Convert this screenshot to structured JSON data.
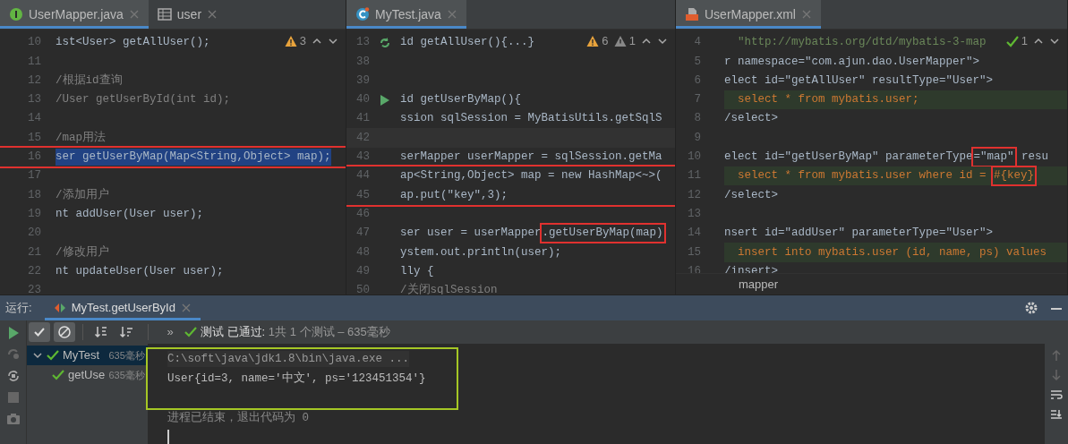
{
  "editors": [
    {
      "tabs": [
        {
          "label": "UserMapper.java",
          "kind": "interface",
          "selected": true
        },
        {
          "label": "user",
          "kind": "table",
          "selected": false
        }
      ],
      "inspections": [
        {
          "kind": "warning",
          "count": "3"
        }
      ],
      "lines": [
        {
          "num": "10",
          "kind": "code",
          "code": "ist<User> getAllUser();"
        },
        {
          "num": "11"
        },
        {
          "num": "12",
          "kind": "comment",
          "code": "/根据id查询"
        },
        {
          "num": "13",
          "kind": "comment",
          "code": "/User getUserById(int id);"
        },
        {
          "num": "14"
        },
        {
          "num": "15",
          "kind": "comment",
          "code": "/map用法"
        },
        {
          "num": "16",
          "kind": "code",
          "code": "ser getUserByMap(Map<String,Object> map);",
          "text_selected": true,
          "boxed": true
        },
        {
          "num": "17"
        },
        {
          "num": "18",
          "kind": "comment",
          "code": "/添加用户"
        },
        {
          "num": "19",
          "kind": "code",
          "code": "nt addUser(User user);"
        },
        {
          "num": "20"
        },
        {
          "num": "21",
          "kind": "comment",
          "code": "/修改用户"
        },
        {
          "num": "22",
          "kind": "code",
          "code": "nt updateUser(User user);"
        },
        {
          "num": "23"
        }
      ]
    },
    {
      "tabs": [
        {
          "label": "MyTest.java",
          "kind": "class",
          "selected": true
        }
      ],
      "inspections": [
        {
          "kind": "warning",
          "count": "6"
        },
        {
          "kind": "weak",
          "count": "1"
        }
      ],
      "lines": [
        {
          "num": "13",
          "kind": "code",
          "code": "id getAllUser(){...}",
          "gutter": {
            "kind": "rerun"
          }
        },
        {
          "num": "38"
        },
        {
          "num": "39"
        },
        {
          "num": "40",
          "kind": "code",
          "code": "id getUserByMap(){",
          "gutter": {
            "kind": "run"
          }
        },
        {
          "num": "41",
          "kind": "code",
          "code": "ssion sqlSession = MyBatisUtils.getSqlS"
        },
        {
          "num": "42",
          "current_line": true
        },
        {
          "num": "43",
          "kind": "code",
          "code": "serMapper userMapper = sqlSession.getMa"
        },
        {
          "num": "44",
          "kind": "code",
          "code": "ap<String,Object> map = new HashMap<~>(",
          "boxed": true
        },
        {
          "num": "45",
          "kind": "code",
          "code": "ap.put(\"key\",3);",
          "boxed": true
        },
        {
          "num": "46"
        },
        {
          "num": "47",
          "kind": "code",
          "code": "ser user = userMapper",
          "boxed_part": ".getUserByMap(map)"
        },
        {
          "num": "48",
          "kind": "code",
          "code": "ystem.out.println(user);"
        },
        {
          "num": "49",
          "kind": "code",
          "code": "lly {"
        },
        {
          "num": "50",
          "kind": "comment",
          "code": "/关闭sqlSession"
        }
      ]
    },
    {
      "tabs": [
        {
          "label": "UserMapper.xml",
          "kind": "xml",
          "selected": true
        }
      ],
      "inspections": [
        {
          "kind": "ok",
          "count": "1"
        }
      ],
      "lines": [
        {
          "num": "4",
          "kind": "string",
          "code": "  \"http://mybatis.org/dtd/mybatis-3-map"
        },
        {
          "num": "5",
          "kind": "code",
          "code": "r namespace=\"com.ajun.dao.UserMapper\">"
        },
        {
          "num": "6",
          "kind": "code",
          "code": "elect id=\"getAllUser\" resultType=\"User\">"
        },
        {
          "num": "7",
          "kind": "sql",
          "code": "  select * from mybatis.user;"
        },
        {
          "num": "8",
          "kind": "code",
          "code": "/select>"
        },
        {
          "num": "9"
        },
        {
          "num": "10",
          "kind": "code",
          "code": "elect id=\"getUserByMap\" parameterType",
          "boxed_part": "=\"map\"",
          "after": " resu"
        },
        {
          "num": "11",
          "kind": "sql",
          "code": "  select * from mybatis.user where id = ",
          "boxed_part": "#{key}"
        },
        {
          "num": "12",
          "kind": "code",
          "code": "/select>"
        },
        {
          "num": "13"
        },
        {
          "num": "14",
          "kind": "code",
          "code": "nsert id=\"addUser\" parameterType=\"User\">"
        },
        {
          "num": "15",
          "kind": "sql",
          "code": "  insert into mybatis.user (id, name, ps) values"
        },
        {
          "num": "16",
          "kind": "code",
          "code": "/insert>"
        }
      ],
      "breadcrumb": "mapper"
    }
  ],
  "run_panel": {
    "label": "运行:",
    "tabs": [
      {
        "label": "MyTest.getUserById",
        "selected": true
      }
    ],
    "toolbar": [
      {
        "kind": "passed",
        "on": true
      },
      {
        "kind": "ignored",
        "on": true
      },
      {
        "kind": "sort-alpha",
        "on": false
      },
      {
        "kind": "sort-duration",
        "on": false
      }
    ],
    "more": "»",
    "status": {
      "label": "测试 已通过:",
      "detail": "1共 1 个测试 – 635毫秒"
    },
    "tree": [
      {
        "label": "MyTest",
        "time": "635毫秒",
        "expanded": true,
        "selected": true,
        "children": [
          {
            "label": "getUse",
            "time": "635毫秒",
            "selected": false
          }
        ]
      }
    ],
    "console": [
      {
        "kind": "command",
        "text": "C:\\soft\\java\\jdk1.8\\bin\\java.exe ...",
        "framed": true
      },
      {
        "kind": "output",
        "text": "User{id=3, name='中文', ps='123451354'}",
        "framed": true
      },
      {
        "kind": "blank",
        "framed": true
      },
      {
        "kind": "exit",
        "text": "进程已结束，退出代码为 0",
        "framed": false
      }
    ]
  }
}
